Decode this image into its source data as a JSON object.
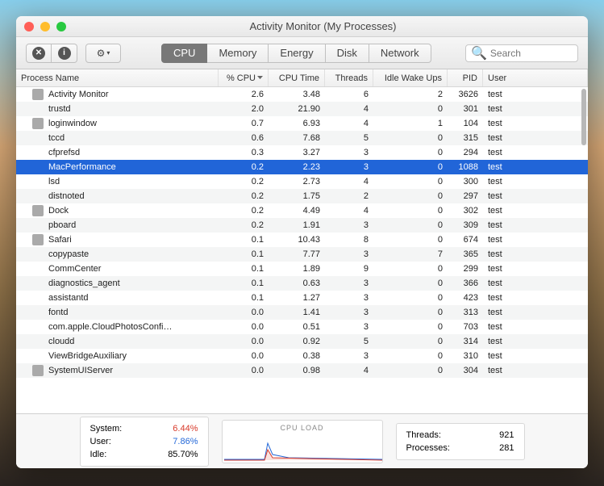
{
  "window": {
    "title": "Activity Monitor (My Processes)"
  },
  "tabs": [
    "CPU",
    "Memory",
    "Energy",
    "Disk",
    "Network"
  ],
  "search": {
    "placeholder": "Search"
  },
  "columns": {
    "name": "Process Name",
    "cpu": "% CPU",
    "time": "CPU Time",
    "threads": "Threads",
    "idle": "Idle Wake Ups",
    "pid": "PID",
    "user": "User"
  },
  "processes": [
    {
      "name": "Activity Monitor",
      "cpu": "2.6",
      "time": "3.48",
      "threads": "6",
      "idle": "2",
      "pid": "3626",
      "user": "test",
      "icon": true
    },
    {
      "name": "trustd",
      "cpu": "2.0",
      "time": "21.90",
      "threads": "4",
      "idle": "0",
      "pid": "301",
      "user": "test"
    },
    {
      "name": "loginwindow",
      "cpu": "0.7",
      "time": "6.93",
      "threads": "4",
      "idle": "1",
      "pid": "104",
      "user": "test",
      "icon": true
    },
    {
      "name": "tccd",
      "cpu": "0.6",
      "time": "7.68",
      "threads": "5",
      "idle": "0",
      "pid": "315",
      "user": "test"
    },
    {
      "name": "cfprefsd",
      "cpu": "0.3",
      "time": "3.27",
      "threads": "3",
      "idle": "0",
      "pid": "294",
      "user": "test"
    },
    {
      "name": "MacPerformance",
      "cpu": "0.2",
      "time": "2.23",
      "threads": "3",
      "idle": "0",
      "pid": "1088",
      "user": "test",
      "selected": true
    },
    {
      "name": "lsd",
      "cpu": "0.2",
      "time": "2.73",
      "threads": "4",
      "idle": "0",
      "pid": "300",
      "user": "test"
    },
    {
      "name": "distnoted",
      "cpu": "0.2",
      "time": "1.75",
      "threads": "2",
      "idle": "0",
      "pid": "297",
      "user": "test"
    },
    {
      "name": "Dock",
      "cpu": "0.2",
      "time": "4.49",
      "threads": "4",
      "idle": "0",
      "pid": "302",
      "user": "test",
      "icon": true
    },
    {
      "name": "pboard",
      "cpu": "0.2",
      "time": "1.91",
      "threads": "3",
      "idle": "0",
      "pid": "309",
      "user": "test"
    },
    {
      "name": "Safari",
      "cpu": "0.1",
      "time": "10.43",
      "threads": "8",
      "idle": "0",
      "pid": "674",
      "user": "test",
      "icon": true
    },
    {
      "name": "copypaste",
      "cpu": "0.1",
      "time": "7.77",
      "threads": "3",
      "idle": "7",
      "pid": "365",
      "user": "test"
    },
    {
      "name": "CommCenter",
      "cpu": "0.1",
      "time": "1.89",
      "threads": "9",
      "idle": "0",
      "pid": "299",
      "user": "test"
    },
    {
      "name": "diagnostics_agent",
      "cpu": "0.1",
      "time": "0.63",
      "threads": "3",
      "idle": "0",
      "pid": "366",
      "user": "test"
    },
    {
      "name": "assistantd",
      "cpu": "0.1",
      "time": "1.27",
      "threads": "3",
      "idle": "0",
      "pid": "423",
      "user": "test"
    },
    {
      "name": "fontd",
      "cpu": "0.0",
      "time": "1.41",
      "threads": "3",
      "idle": "0",
      "pid": "313",
      "user": "test"
    },
    {
      "name": "com.apple.CloudPhotosConfi…",
      "cpu": "0.0",
      "time": "0.51",
      "threads": "3",
      "idle": "0",
      "pid": "703",
      "user": "test"
    },
    {
      "name": "cloudd",
      "cpu": "0.0",
      "time": "0.92",
      "threads": "5",
      "idle": "0",
      "pid": "314",
      "user": "test"
    },
    {
      "name": "ViewBridgeAuxiliary",
      "cpu": "0.0",
      "time": "0.38",
      "threads": "3",
      "idle": "0",
      "pid": "310",
      "user": "test"
    },
    {
      "name": "SystemUIServer",
      "cpu": "0.0",
      "time": "0.98",
      "threads": "4",
      "idle": "0",
      "pid": "304",
      "user": "test",
      "icon": true
    }
  ],
  "summary": {
    "system_label": "System:",
    "system_val": "6.44%",
    "user_label": "User:",
    "user_val": "7.86%",
    "idle_label": "Idle:",
    "idle_val": "85.70%",
    "chart_title": "CPU LOAD",
    "threads_label": "Threads:",
    "threads_val": "921",
    "procs_label": "Processes:",
    "procs_val": "281"
  }
}
